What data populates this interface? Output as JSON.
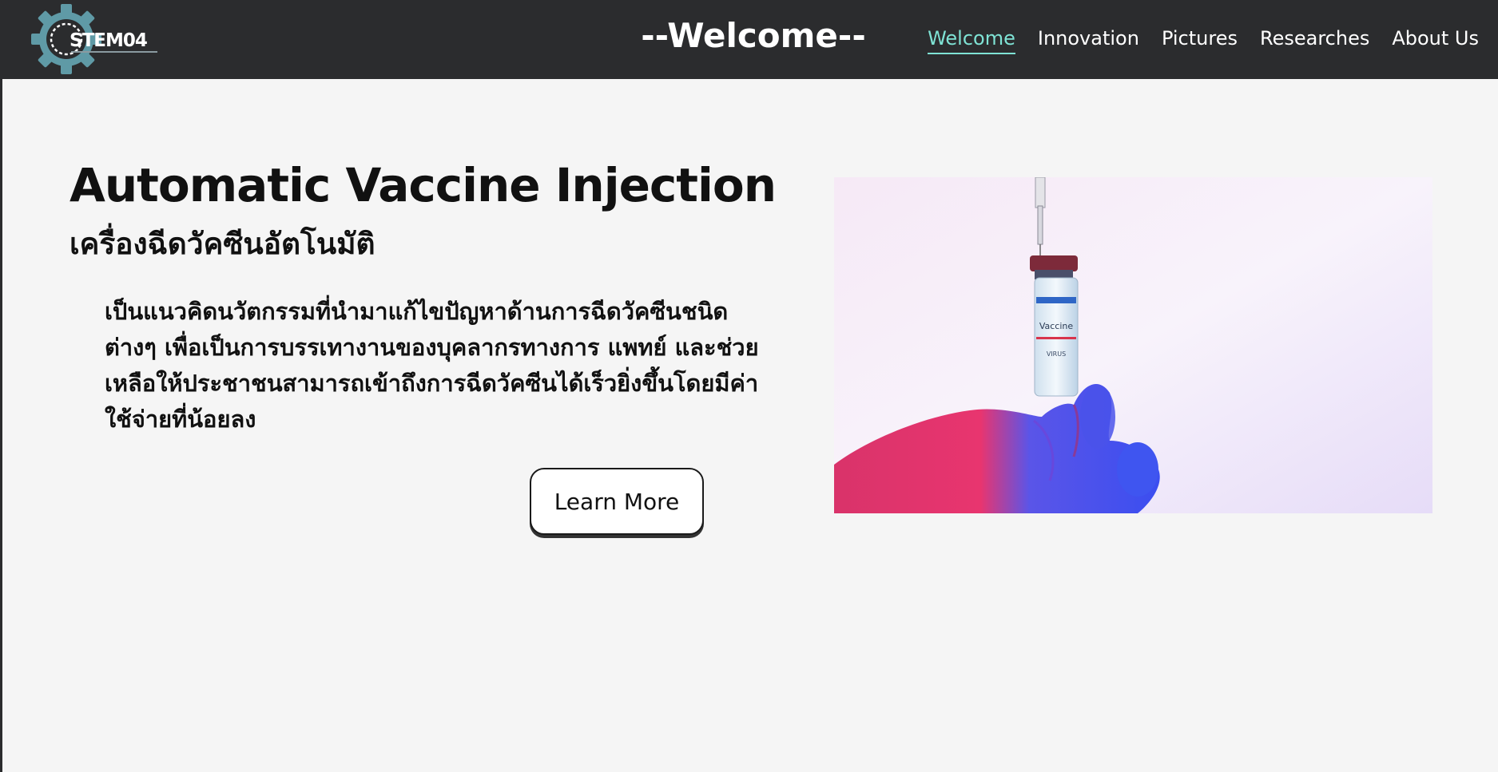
{
  "header": {
    "logo_text": "STEM04",
    "center_title": "--Welcome--",
    "nav": [
      {
        "label": "Welcome",
        "active": true
      },
      {
        "label": "Innovation",
        "active": false
      },
      {
        "label": "Pictures",
        "active": false
      },
      {
        "label": "Researches",
        "active": false
      },
      {
        "label": "About Us",
        "active": false
      }
    ]
  },
  "hero": {
    "title": "Automatic Vaccine Injection",
    "subtitle": "เครื่องฉีดวัคซีนอัตโนมัติ",
    "body": "เป็นแนวคิดนวัตกรรมที่นำมาแก้ไขปัญหาด้านการฉีดวัคซีนชนิดต่างๆ เพื่อเป็นการบรรเทางานของบุคลากรทางการ แพทย์ และช่วยเหลือให้ประชาชนสามารถเข้าถึงการฉีดวัคซีนได้เร็วยิ่งขึ้นโดยมีค่าใช้จ่ายที่น้อยลง",
    "button_label": "Learn More",
    "image": {
      "vial_label": "Vaccine",
      "vial_sublabel": "VIRUS"
    }
  },
  "colors": {
    "header_bg": "#2b2c2e",
    "page_bg": "#f5f5f5",
    "nav_active": "#7fe3d5",
    "gear": "#5f9aa6"
  },
  "icons": {
    "logo": "gear-icon"
  }
}
